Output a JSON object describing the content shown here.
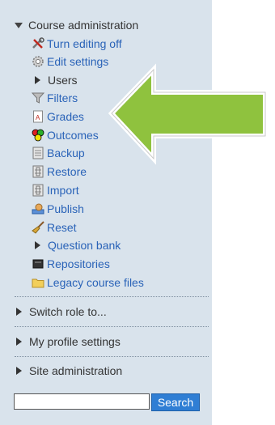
{
  "block": {
    "course_admin_title": "Course administration",
    "items": [
      {
        "label": "Turn editing off",
        "icon": "tools-icon"
      },
      {
        "label": "Edit settings",
        "icon": "gear-icon"
      },
      {
        "label": "Users",
        "icon": "expand-arrow-icon"
      },
      {
        "label": "Filters",
        "icon": "funnel-icon"
      },
      {
        "label": "Grades",
        "icon": "grades-document-icon"
      },
      {
        "label": "Outcomes",
        "icon": "outcomes-icon"
      },
      {
        "label": "Backup",
        "icon": "backup-icon"
      },
      {
        "label": "Restore",
        "icon": "restore-icon"
      },
      {
        "label": "Import",
        "icon": "import-icon"
      },
      {
        "label": "Publish",
        "icon": "publish-icon"
      },
      {
        "label": "Reset",
        "icon": "reset-broom-icon"
      },
      {
        "label": "Question bank",
        "icon": "expand-arrow-icon"
      },
      {
        "label": "Repositories",
        "icon": "repository-icon"
      },
      {
        "label": "Legacy course files",
        "icon": "folder-icon"
      }
    ],
    "sections": {
      "switch_role": "Switch role to...",
      "profile": "My profile settings",
      "site_admin": "Site administration"
    }
  },
  "search": {
    "value": "",
    "button_label": "Search"
  },
  "colors": {
    "panel_bg": "#d9e3ec",
    "link": "#2a63b8",
    "arrow_fill": "#8fc23e",
    "button": "#2f7ed4"
  }
}
